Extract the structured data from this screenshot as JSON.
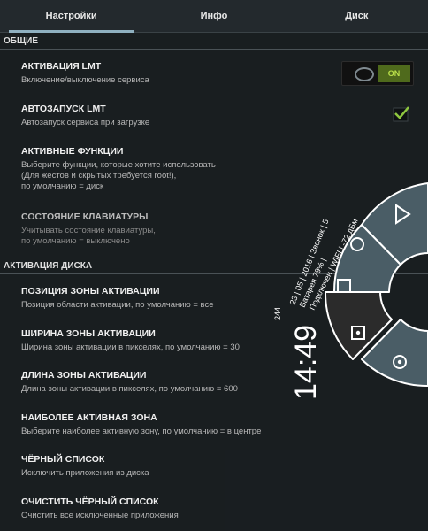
{
  "tabs": [
    {
      "label": "Настройки",
      "active": true
    },
    {
      "label": "Инфо",
      "active": false
    },
    {
      "label": "Диск",
      "active": false
    }
  ],
  "sections": {
    "general": "ОБЩИЕ",
    "activation": "АКТИВАЦИЯ ДИСКА"
  },
  "items": {
    "lmt_activation": {
      "title": "АКТИВАЦИЯ LMT",
      "summary": "Включение/выключение сервиса"
    },
    "autostart": {
      "title": "АВТОЗАПУСК LMT",
      "summary": "Автозапуск сервиса при загрузке"
    },
    "active_functions": {
      "title": "АКТИВНЫЕ ФУНКЦИИ",
      "summary_lines": [
        "Выберите функции, которые хотите использовать",
        "(Для жестов и скрытых требуется root!),",
        "по умолчанию = диск"
      ]
    },
    "keyboard_state": {
      "title": "СОСТОЯНИЕ КЛАВИАТУРЫ",
      "summary_lines": [
        "Учитывать состояние клавиатуры,",
        "по умолчанию = выключено"
      ]
    },
    "zone_position": {
      "title": "ПОЗИЦИЯ ЗОНЫ АКТИВАЦИИ",
      "summary": "Позиция области активации, по умолчанию = все"
    },
    "zone_width": {
      "title": "ШИРИНА ЗОНЫ АКТИВАЦИИ",
      "summary": "Ширина зоны активации в пикселях, по умолчанию = 30"
    },
    "zone_length": {
      "title": "ДЛИНА ЗОНЫ АКТИВАЦИИ",
      "summary": "Длина зоны активации в пикселях, по умолчанию = 600"
    },
    "most_active_zone": {
      "title": "НАИБОЛЕЕ АКТИВНАЯ ЗОНА",
      "summary": "Выберите наиболее активную зону, по умолчанию = в центре"
    },
    "blacklist": {
      "title": "ЧЁРНЫЙ СПИСОК",
      "summary": "Исключить приложения из диска"
    },
    "clear_blacklist": {
      "title": "ОЧИСТИТЬ ЧЁРНЫЙ СПИСОК",
      "summary": "Очистить все исключенные приложения"
    }
  },
  "toggle": {
    "state_label": "ON",
    "checked": true
  },
  "autostart_checked": true,
  "pie_overlay": {
    "clock": "14:49",
    "day_of_year": "244",
    "info_lines": [
      "23 | 05 | 2016 | Звонок | 5",
      "Батарея 79% |",
      "Подключен | WIFI | -72 дБм"
    ],
    "buttons": [
      "triangle-back",
      "circle-home",
      "square-recents",
      "dot-square",
      "dot-circle"
    ],
    "colors": {
      "segment": "#4a5d66",
      "segment_active": "#2b2b2b",
      "outline": "#ffffff",
      "toggle_on": "#4f6a1c"
    }
  }
}
